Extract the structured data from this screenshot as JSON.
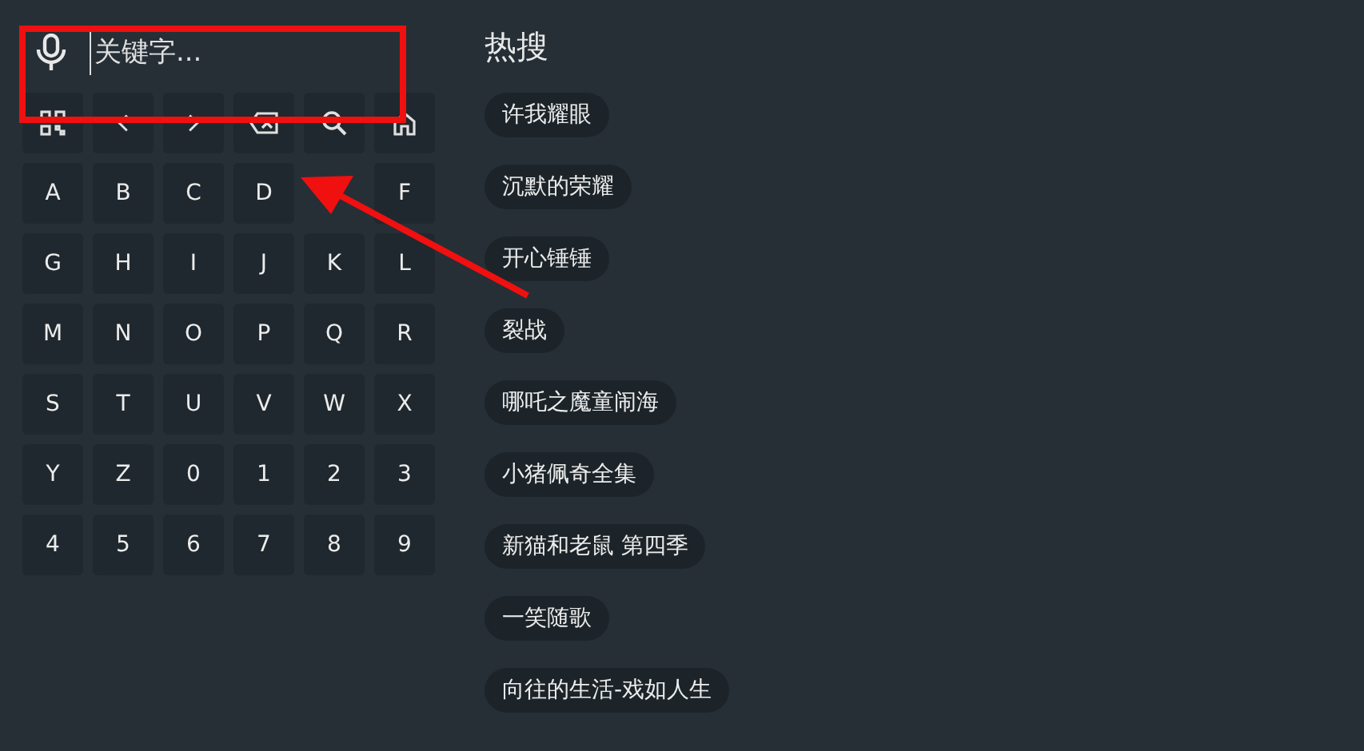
{
  "search": {
    "placeholder": "关键字..."
  },
  "toolbar_keys": [
    {
      "kind": "grid"
    },
    {
      "kind": "left"
    },
    {
      "kind": "right"
    },
    {
      "kind": "backspace"
    },
    {
      "kind": "search"
    },
    {
      "kind": "home"
    }
  ],
  "keys": [
    {
      "label": "A"
    },
    {
      "label": "B"
    },
    {
      "label": "C"
    },
    {
      "label": "D"
    },
    {
      "label": "F",
      "skip_before": true
    },
    {
      "label": "G"
    },
    {
      "label": "H"
    },
    {
      "label": "I"
    },
    {
      "label": "J"
    },
    {
      "label": "K"
    },
    {
      "label": "L"
    },
    {
      "label": "M"
    },
    {
      "label": "N"
    },
    {
      "label": "O"
    },
    {
      "label": "P"
    },
    {
      "label": "Q"
    },
    {
      "label": "R"
    },
    {
      "label": "S"
    },
    {
      "label": "T"
    },
    {
      "label": "U"
    },
    {
      "label": "V"
    },
    {
      "label": "W"
    },
    {
      "label": "X"
    },
    {
      "label": "Y"
    },
    {
      "label": "Z"
    },
    {
      "label": "0"
    },
    {
      "label": "1"
    },
    {
      "label": "2"
    },
    {
      "label": "3"
    },
    {
      "label": "4"
    },
    {
      "label": "5"
    },
    {
      "label": "6"
    },
    {
      "label": "7"
    },
    {
      "label": "8"
    },
    {
      "label": "9"
    }
  ],
  "hot": {
    "title": "热搜",
    "items": [
      "许我耀眼",
      "沉默的荣耀",
      "开心锤锤",
      "裂战",
      "哪吒之魔童闹海",
      "小猪佩奇全集",
      "新猫和老鼠 第四季",
      "一笑随歌",
      "向往的生活-戏如人生"
    ]
  }
}
